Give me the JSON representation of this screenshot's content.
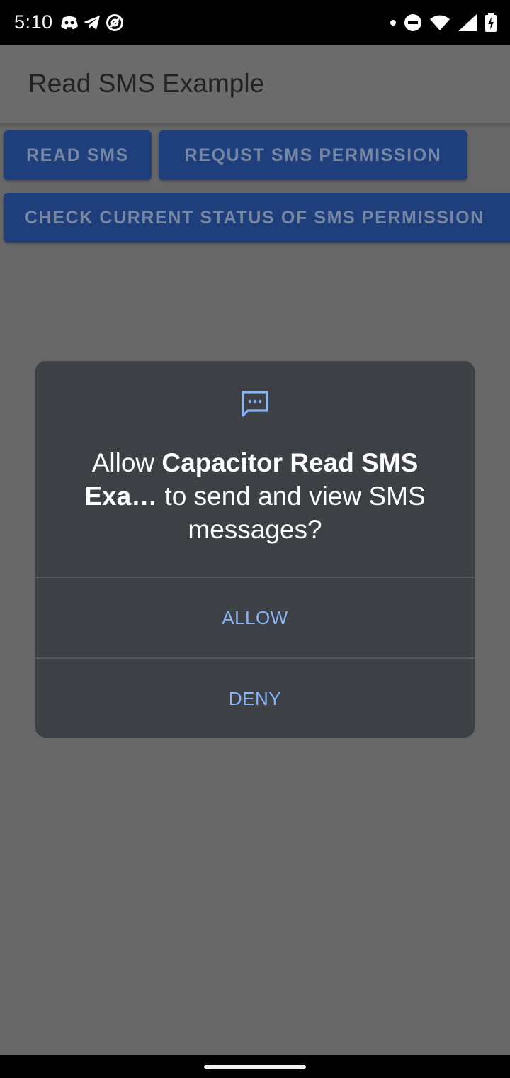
{
  "status_bar": {
    "time": "5:10",
    "left_icons": [
      "discord-icon",
      "telegram-icon",
      "at-sign-icon"
    ],
    "right_icons": [
      "notification-dot-icon",
      "do-not-disturb-icon",
      "wifi-icon",
      "signal-icon",
      "battery-charging-icon"
    ]
  },
  "app_bar": {
    "title": "Read SMS Example"
  },
  "buttons": {
    "read_sms": "READ SMS",
    "request_permission": "REQUST SMS PERMISSION",
    "check_status": "CHECK CURRENT STATUS OF SMS PERMISSION"
  },
  "dialog": {
    "icon": "sms-message-icon",
    "message_prefix": "Allow ",
    "app_name": "Capacitor Read SMS Exa…",
    "message_suffix": " to send and view SMS messages?",
    "allow_label": "ALLOW",
    "deny_label": "DENY"
  },
  "colors": {
    "scrim_background": "#676767",
    "button_blue": "#1e3f7c",
    "dialog_background": "#3d4044",
    "dialog_accent": "#8ab4f8"
  }
}
